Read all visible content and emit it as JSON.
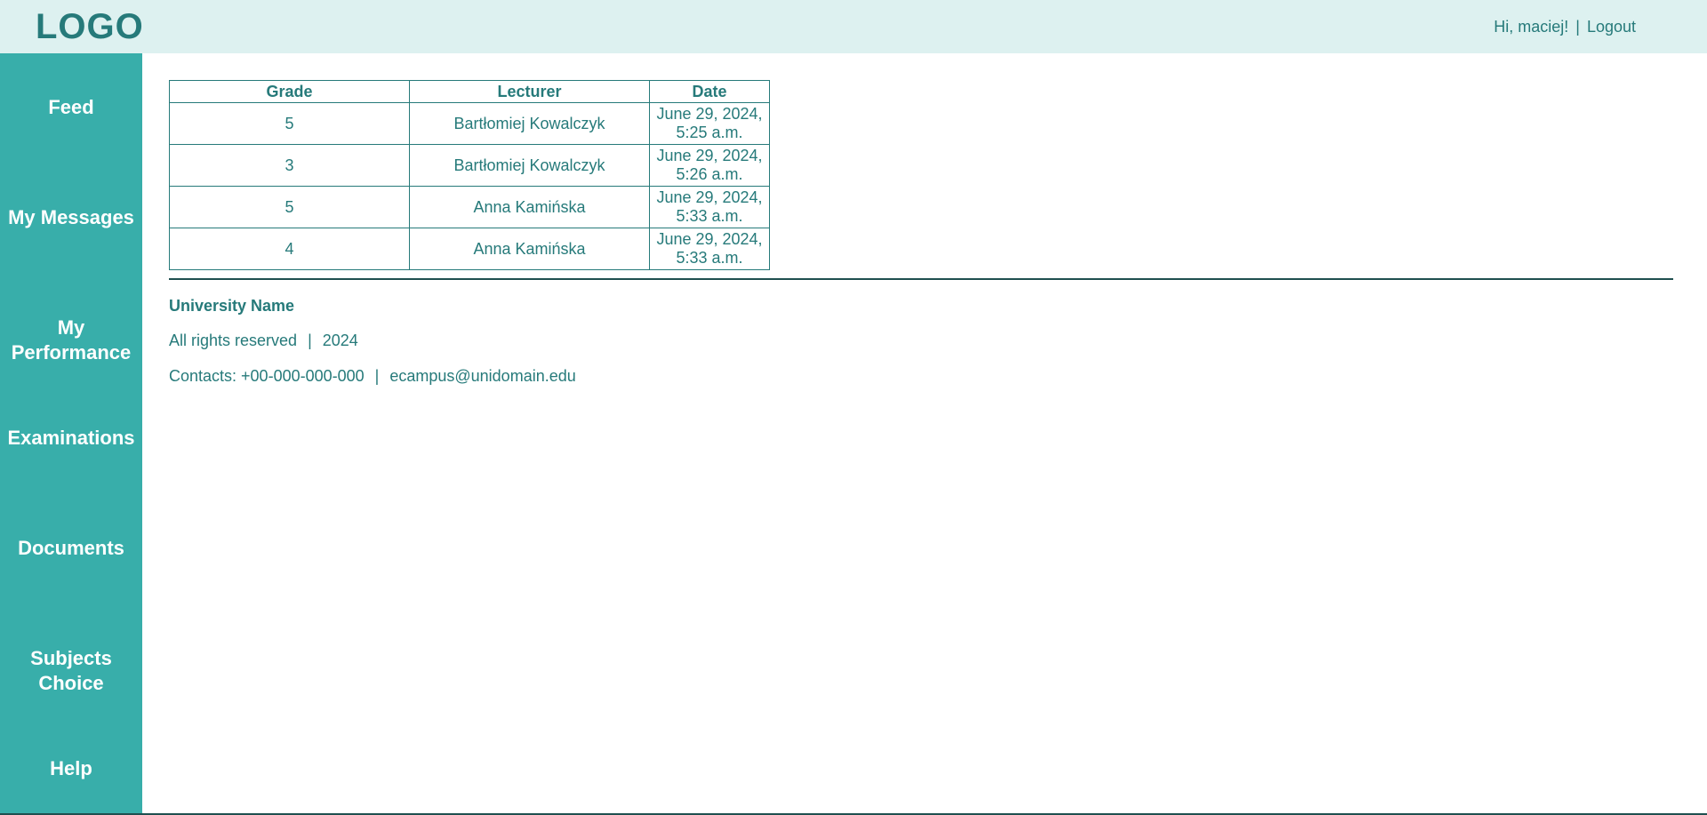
{
  "header": {
    "logo": "LOGO",
    "greeting": "Hi, maciej!",
    "separator": "|",
    "logout": "Logout"
  },
  "sidebar": {
    "items": [
      {
        "label": "Feed"
      },
      {
        "label": "My Messages"
      },
      {
        "label": "My Performance"
      },
      {
        "label": "Examinations"
      },
      {
        "label": "Documents"
      },
      {
        "label": "Subjects Choice"
      },
      {
        "label": "Help"
      }
    ]
  },
  "table": {
    "headers": [
      "Grade",
      "Lecturer",
      "Date"
    ],
    "rows": [
      {
        "grade": "5",
        "lecturer": "Bartłomiej Kowalczyk",
        "date": "June 29, 2024, 5:25 a.m."
      },
      {
        "grade": "3",
        "lecturer": "Bartłomiej Kowalczyk",
        "date": "June 29, 2024, 5:26 a.m."
      },
      {
        "grade": "5",
        "lecturer": "Anna Kamińska",
        "date": "June 29, 2024, 5:33 a.m."
      },
      {
        "grade": "4",
        "lecturer": "Anna Kamińska",
        "date": "June 29, 2024, 5:33 a.m."
      }
    ]
  },
  "footer": {
    "university": "University Name",
    "rights": "All rights reserved",
    "year": "2024",
    "separator": "|",
    "contacts_label": "Contacts: +00-000-000-000",
    "email": "ecampus@unidomain.edu"
  },
  "colors": {
    "topbar_bg": "#ddf1f0",
    "sidebar_bg": "#38aeaa",
    "accent_text": "#267a7a",
    "divider": "#1f4f4f"
  }
}
